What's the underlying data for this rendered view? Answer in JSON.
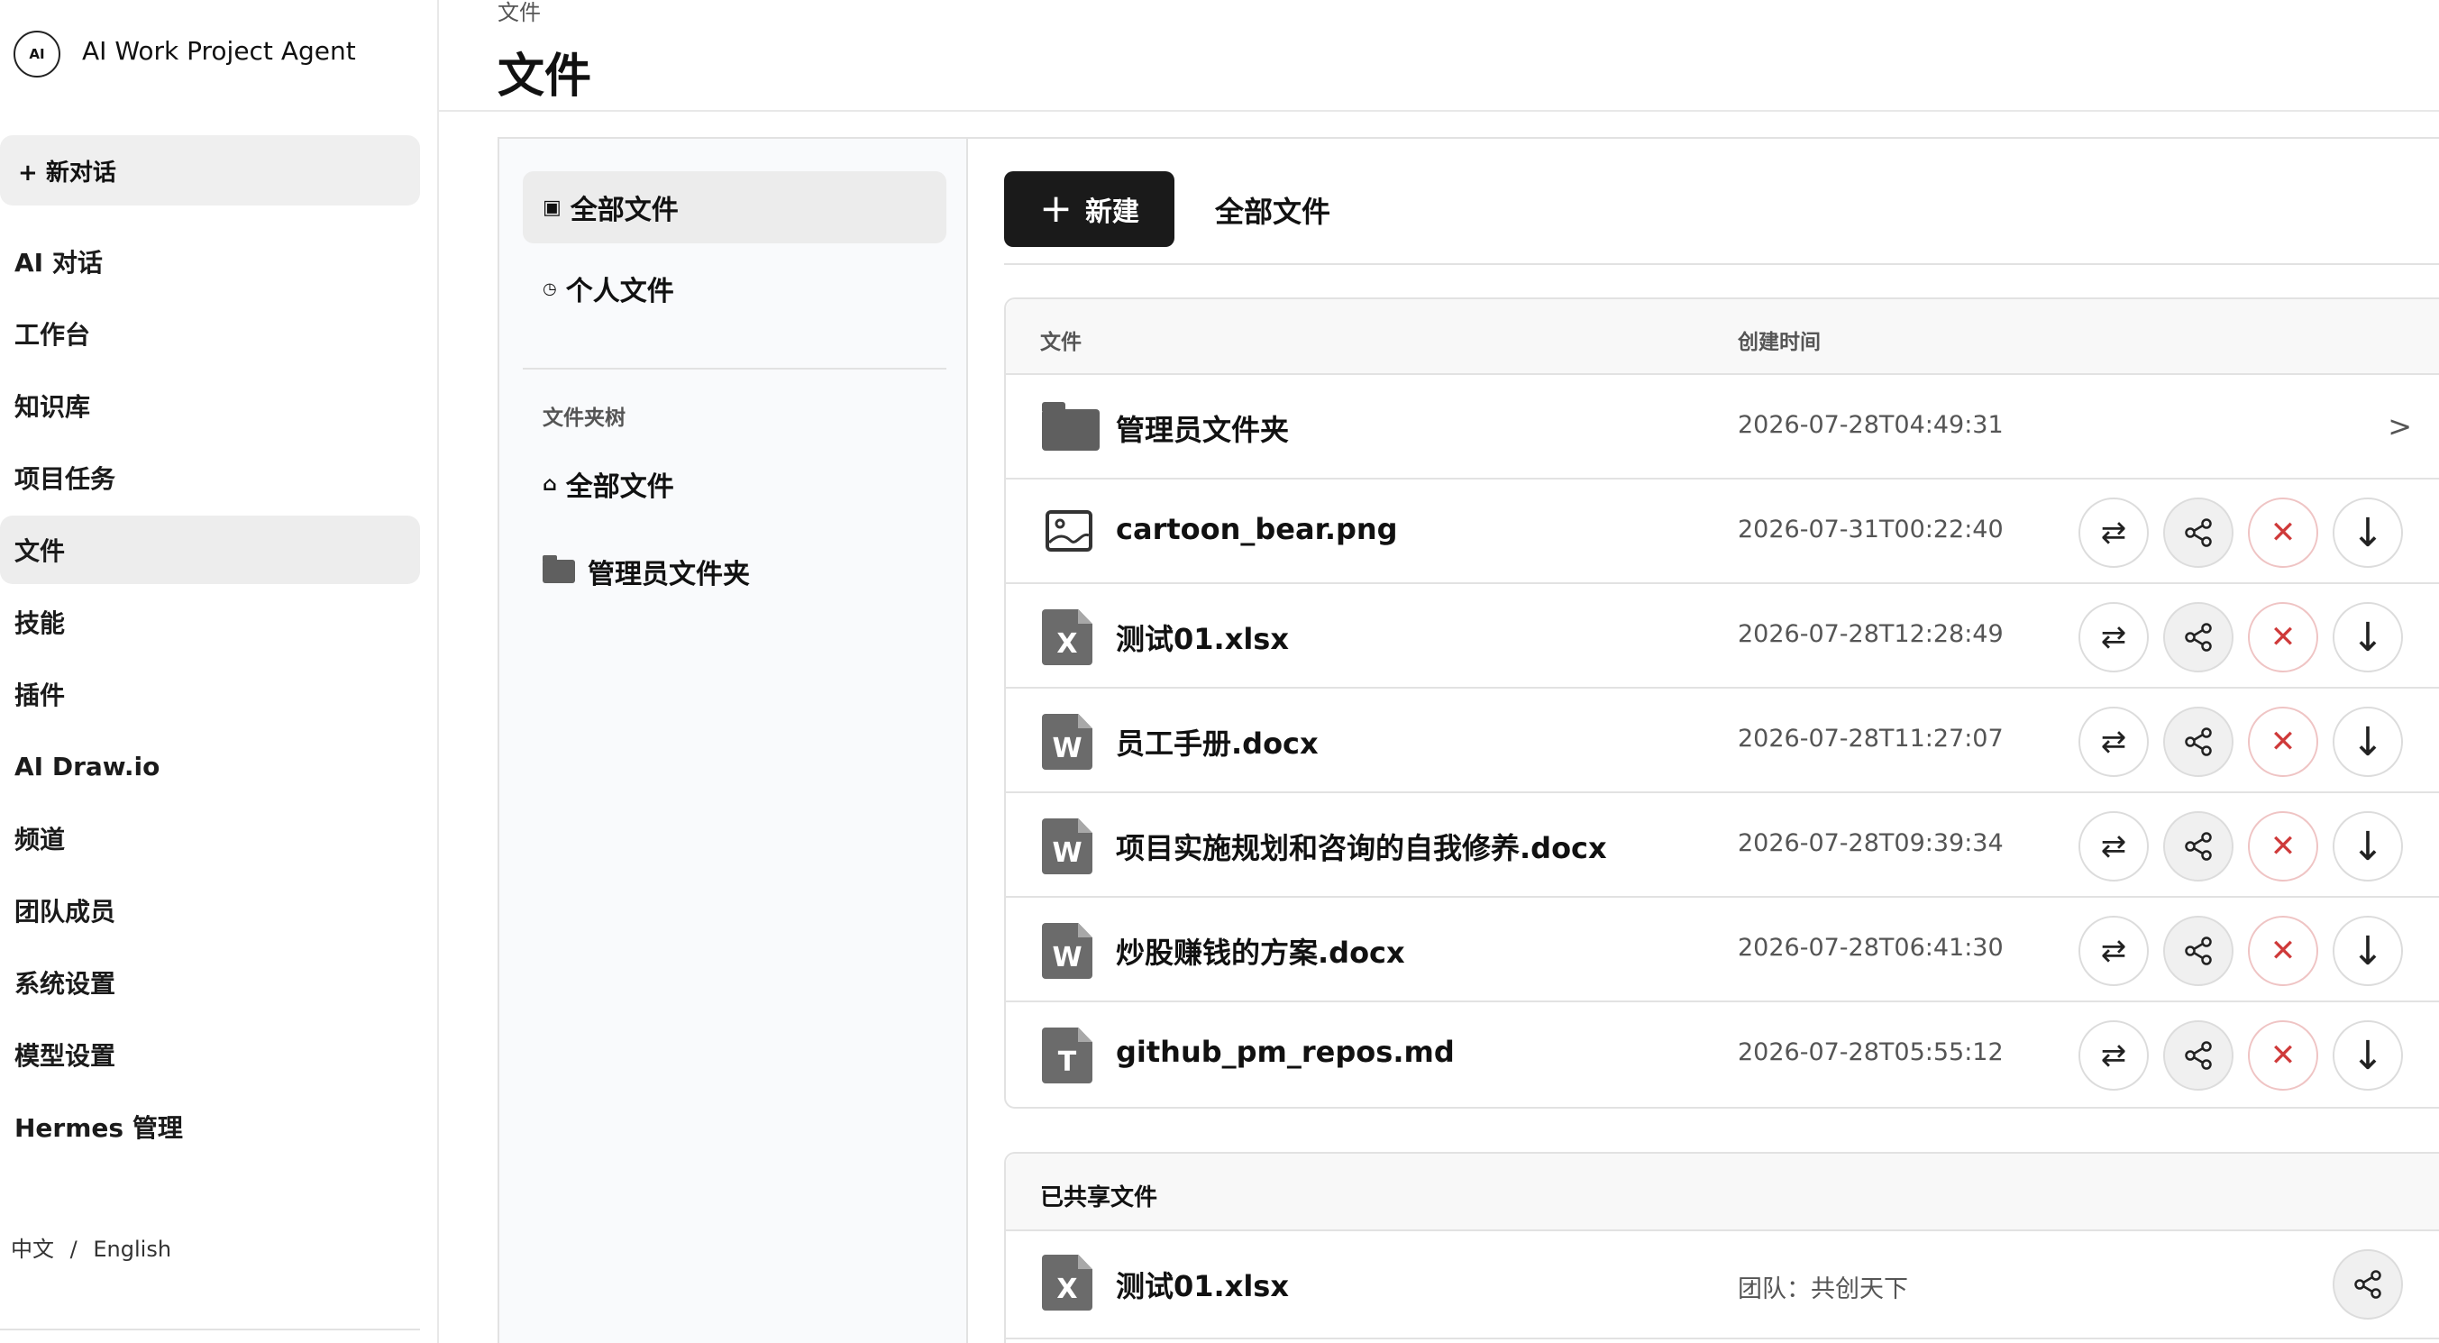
{
  "app": {
    "logo": "AI",
    "name": "AI Work Project Agent"
  },
  "sidebar": {
    "new_chat": "+ 新对话",
    "items": [
      {
        "label": "AI 对话"
      },
      {
        "label": "工作台"
      },
      {
        "label": "知识库"
      },
      {
        "label": "项目任务"
      },
      {
        "label": "文件",
        "active": true
      },
      {
        "label": "技能"
      },
      {
        "label": "插件"
      },
      {
        "label": "AI Draw.io"
      },
      {
        "label": "频道"
      },
      {
        "label": "团队成员"
      },
      {
        "label": "系统设置"
      },
      {
        "label": "模型设置"
      },
      {
        "label": "Hermes 管理"
      }
    ],
    "lang": {
      "zh": "中文",
      "sep": "/",
      "en": "English"
    }
  },
  "header": {
    "breadcrumb": "文件",
    "title": "文件"
  },
  "tree": {
    "items": [
      {
        "icon": "▣",
        "label": "全部文件",
        "active": true
      },
      {
        "icon": "◷",
        "label": "个人文件"
      }
    ],
    "section_label": "文件夹树",
    "folders": [
      {
        "icon": "⌂",
        "label": "全部文件"
      },
      {
        "label": "管理员文件夹"
      }
    ]
  },
  "toolbar": {
    "new_label": "新建",
    "new_icon": "+",
    "filter_label": "全部文件"
  },
  "table": {
    "columns": {
      "name": "文件",
      "created": "创建时间"
    },
    "rows": [
      {
        "type": "folder",
        "name": "管理员文件夹",
        "created": "2026-07-28T04:49:31",
        "chevron": ">"
      },
      {
        "type": "image",
        "name": "cartoon_bear.png",
        "created": "2026-07-31T00:22:40"
      },
      {
        "type": "xlsx",
        "letter": "X",
        "name": "测试01.xlsx",
        "created": "2026-07-28T12:28:49"
      },
      {
        "type": "docx",
        "letter": "W",
        "name": "员工手册.docx",
        "created": "2026-07-28T11:27:07"
      },
      {
        "type": "docx",
        "letter": "W",
        "name": "项目实施规划和咨询的自我修养.docx",
        "created": "2026-07-28T09:39:34"
      },
      {
        "type": "docx",
        "letter": "W",
        "name": "炒股赚钱的方案.docx",
        "created": "2026-07-28T06:41:30"
      },
      {
        "type": "md",
        "letter": "T",
        "name": "github_pm_repos.md",
        "created": "2026-07-28T05:55:12"
      }
    ],
    "actions": {
      "move": "⇄",
      "share": "share-icon",
      "delete": "✕",
      "download": "↓"
    }
  },
  "shared": {
    "title": "已共享文件",
    "rows": [
      {
        "type": "xlsx",
        "letter": "X",
        "name": "测试01.xlsx",
        "team": "团队：共创天下"
      }
    ]
  },
  "colors": {
    "primary": "#1a1a1a",
    "danger": "#cf3a3a",
    "icon_gray": "#6b6b6b"
  }
}
